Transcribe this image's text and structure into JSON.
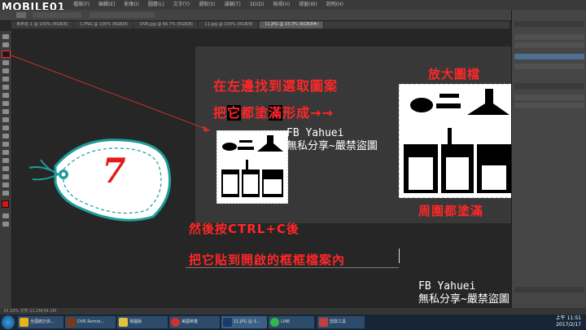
{
  "logo": {
    "text": "MOBILE01"
  },
  "menubar": {
    "items": [
      "檔案(F)",
      "編輯(E)",
      "影像(I)",
      "圖層(L)",
      "文字(Y)",
      "選取(S)",
      "濾鏡(T)",
      "3D(D)",
      "檢視(V)",
      "視窗(W)",
      "說明(H)"
    ]
  },
  "tabs": [
    "未命名-1 @ 100% (RGB/8)",
    "1.PNG @ 100% (RGB/8)",
    "DVR.jpg @ 66.7% (RGB/8)",
    "11.jpg @ 100% (RGB/8)",
    "11.JPG @ 33.3% (RGB/8#)"
  ],
  "annotations": {
    "line1": "在左邊找到選取圖案",
    "line2_a": "把",
    "line2_b": "它",
    "line2_c": "都塗",
    "line2_d": "滿",
    "line2_e": "形成→→",
    "zoom_label": "放大圖檔",
    "fill_label": "周圍都塗滿",
    "step1": "然後按CTRL+C後",
    "step2": "把它貼到開啟的框框檔案內"
  },
  "tag": {
    "number": "7"
  },
  "watermarks": {
    "wm1_line1": "FB Yahuei",
    "wm1_line2": "無私分享~嚴禁盜圖",
    "wm2_line1": "FB Yahuei",
    "wm2_line2": "無私分享~嚴禁盜圖"
  },
  "statusbar": {
    "text": "33.33%   文件:11.2M/34.1M"
  },
  "taskbar": {
    "items": [
      "全國統計資...",
      "DVR Remot...",
      "電腦版",
      "美國英雄",
      "11.JPG @ 3...",
      "LINE",
      "剪取工具"
    ],
    "clock_time": "上午 11:51",
    "clock_date": "2017/2/17"
  },
  "colors": {
    "accent_red": "#ff2727",
    "tag_teal": "#1e9c9c"
  }
}
